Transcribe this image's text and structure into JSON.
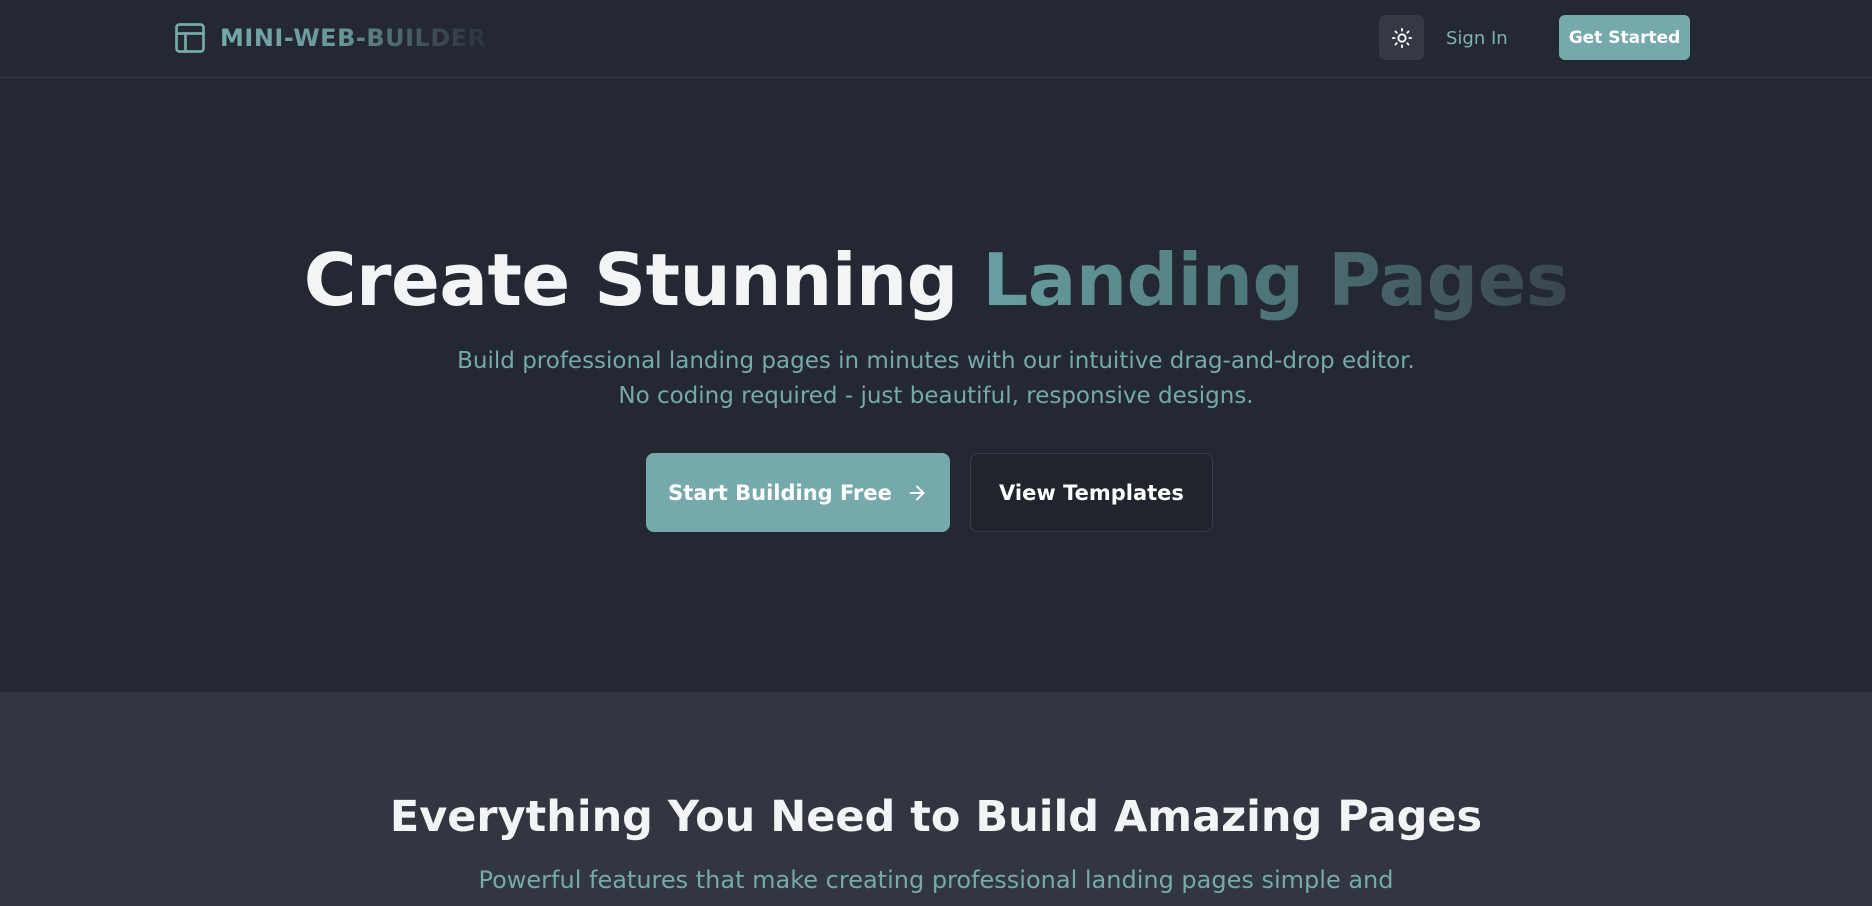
{
  "header": {
    "brand_name": "MINI-WEB-BUILDER",
    "brand_icon": "layout-icon",
    "theme_toggle_icon": "sun-icon",
    "sign_in_label": "Sign In",
    "get_started_label": "Get Started"
  },
  "hero": {
    "title_part1": "Create Stunning ",
    "title_part2": "Landing Pages",
    "subtitle_line1": "Build professional landing pages in minutes with our intuitive drag-and-drop editor.",
    "subtitle_line2": "No coding required - just beautiful, responsive designs.",
    "primary_button_label": "Start Building Free",
    "primary_button_icon": "arrow-right-icon",
    "secondary_button_label": "View Templates"
  },
  "features": {
    "title": "Everything You Need to Build Amazing Pages",
    "subtitle": "Powerful features that make creating professional landing pages simple and"
  },
  "colors": {
    "background": "#232833",
    "section_background": "#323640",
    "accent": "#75a9ab",
    "text_primary": "#f3f4f6"
  }
}
